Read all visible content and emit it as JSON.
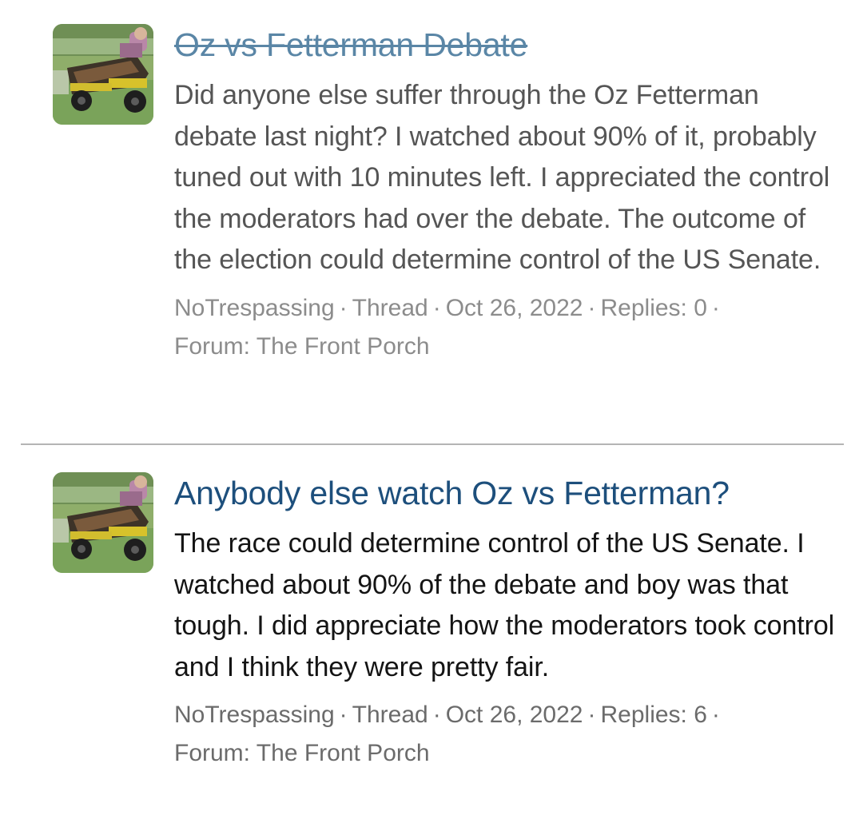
{
  "results": [
    {
      "title": "Oz vs Fetterman Debate",
      "snippet": "Did anyone else suffer through the Oz Fetterman debate last night? I watched about 90% of it, probably tuned out with 10 minutes left. I appreciated the control the moderators had over the debate. The outcome of the election could determine control of the US Senate.",
      "author": "NoTrespassing",
      "type": "Thread",
      "date": "Oct 26, 2022",
      "replies": "Replies: 0",
      "forum": "Forum: The Front Porch",
      "separator": "·",
      "avatar_icon": "user-avatar-icon"
    },
    {
      "title": "Anybody else watch Oz vs Fetterman?",
      "snippet": "The race could determine control of the US Senate. I watched about 90% of the debate and boy was that tough. I did appreciate how the moderators took control and I think they were pretty fair.",
      "author": "NoTrespassing",
      "type": "Thread",
      "date": "Oct 26, 2022",
      "replies": "Replies: 6",
      "forum": "Forum: The Front Porch",
      "separator": "·",
      "avatar_icon": "user-avatar-icon"
    }
  ],
  "colors": {
    "deleted_title": "#5a86a6",
    "active_title": "#1d4f7c",
    "meta_text": "#8c8c8c",
    "divider": "#b4b4b4"
  }
}
